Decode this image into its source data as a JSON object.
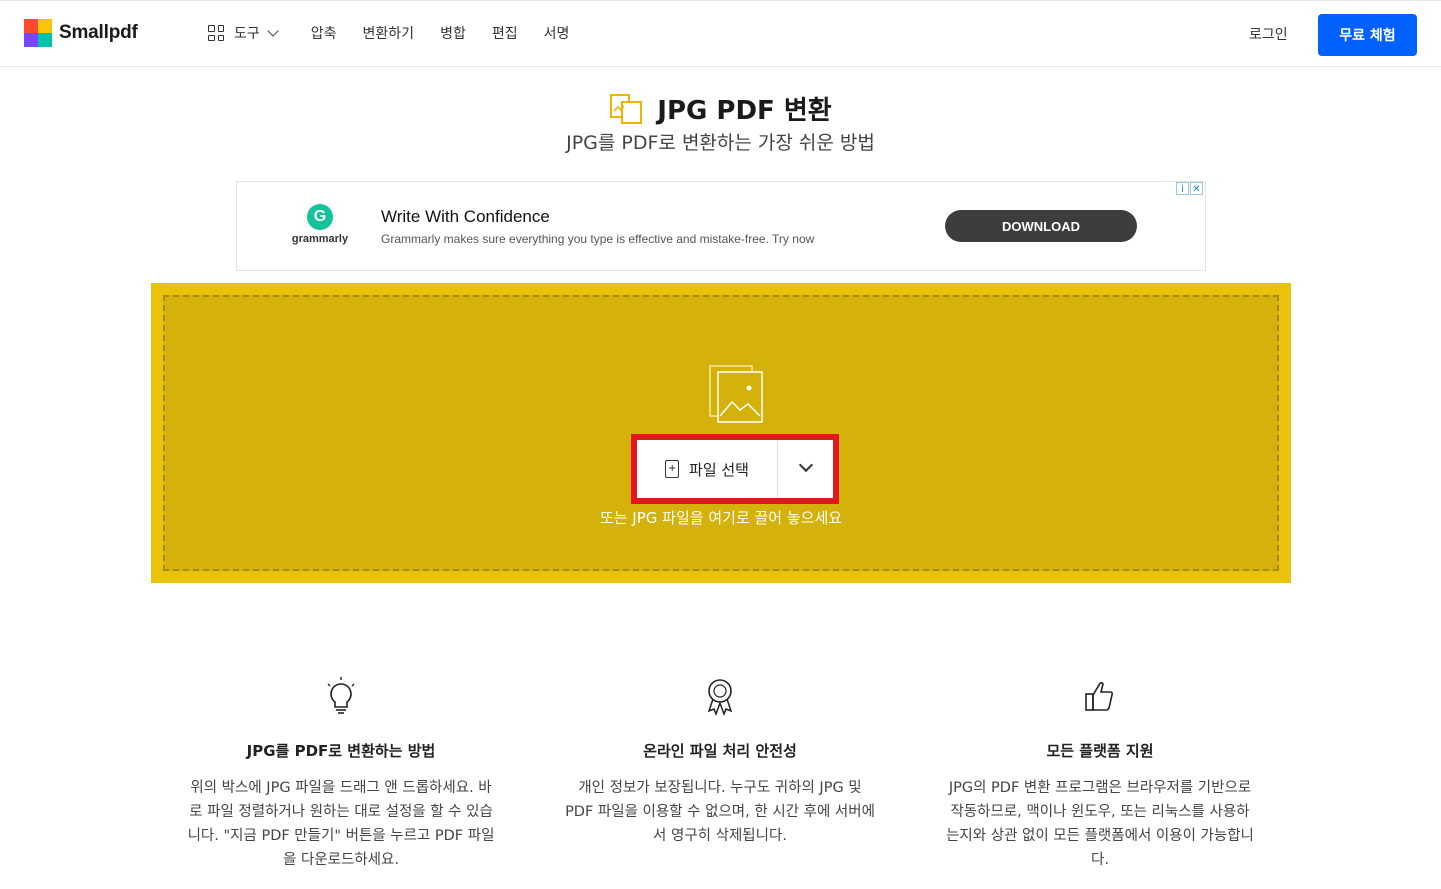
{
  "header": {
    "logo_text": "Smallpdf",
    "nav_tools": "도구",
    "nav_items": [
      "압축",
      "변환하기",
      "병합",
      "편집",
      "서명"
    ],
    "login": "로그인",
    "trial_button": "무료 체험"
  },
  "hero": {
    "title": "JPG PDF 변환",
    "subtitle": "JPG를 PDF로 변환하는 가장 쉬운 방법"
  },
  "ad": {
    "brand": "grammarly",
    "headline": "Write With Confidence",
    "description": "Grammarly makes sure everything you type is effective and mistake-free. Try now",
    "button": "DOWNLOAD"
  },
  "dropzone": {
    "choose_file": "파일 선택",
    "hint": "또는 JPG 파일을 여기로 끌어 놓으세요"
  },
  "features": [
    {
      "icon": "lightbulb-icon",
      "title": "JPG를 PDF로 변환하는 방법",
      "text": "위의 박스에 JPG 파일을 드래그 앤 드롭하세요. 바로 파일 정렬하거나 원하는 대로 설정을 할 수 있습니다. \"지금 PDF 만들기\" 버튼을 누르고 PDF 파일을 다운로드하세요."
    },
    {
      "icon": "award-ribbon-icon",
      "title": "온라인 파일 처리 안전성",
      "text": "개인 정보가 보장됩니다. 누구도 귀하의 JPG 및 PDF 파일을 이용할 수 없으며, 한 시간 후에 서버에서 영구히 삭제됩니다."
    },
    {
      "icon": "thumbs-up-icon",
      "title": "모든 플랫폼 지원",
      "text": "JPG의 PDF 변환 프로그램은 브라우저를 기반으로 작동하므로, 맥이나 윈도우, 또는 리눅스를 사용하는지와 상관 없이 모든 플랫폼에서 이용이 가능합니다."
    }
  ],
  "colors": {
    "accent": "#0061fe",
    "drop_outer": "#e8c20b",
    "drop_inner": "#d4b10b",
    "highlight": "#e5151c"
  }
}
